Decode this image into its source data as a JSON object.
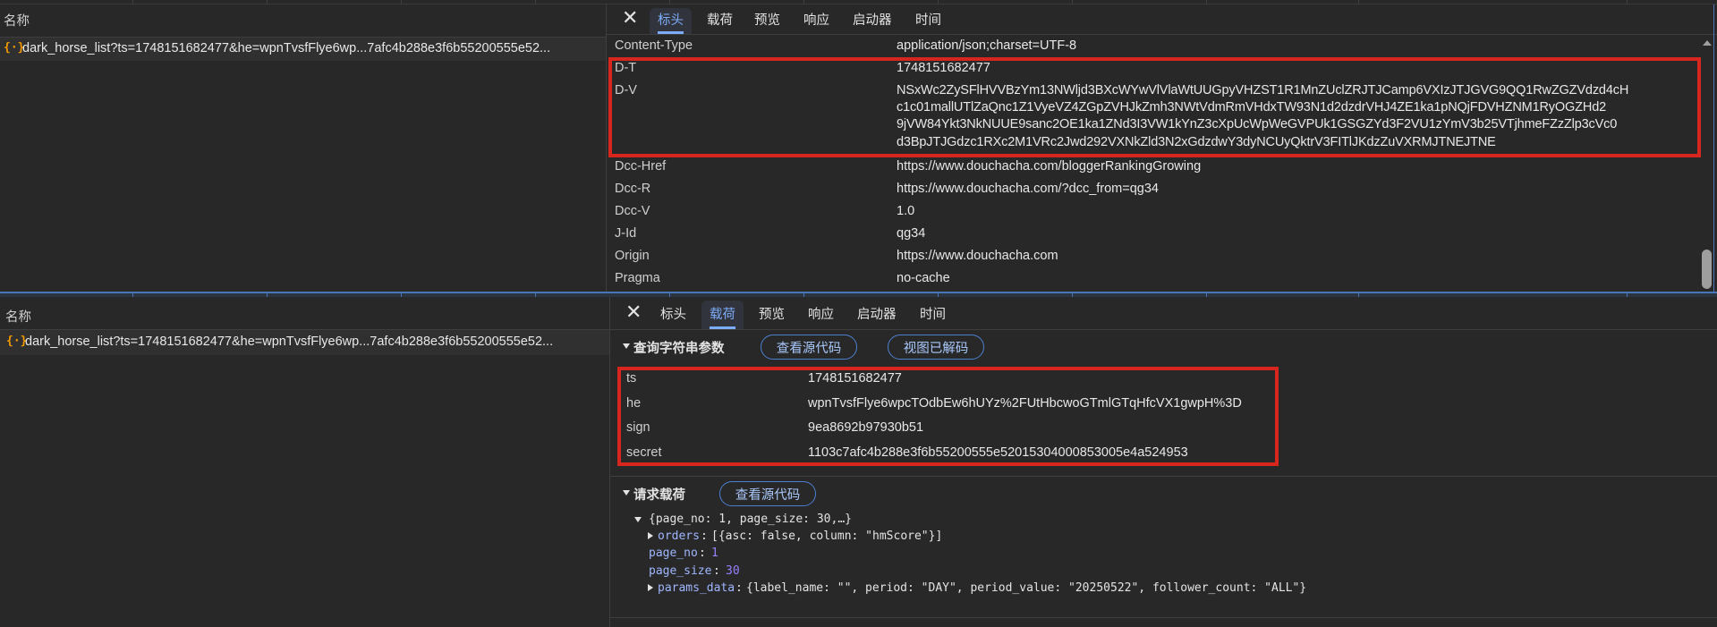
{
  "top": {
    "name_header": "名称",
    "request_name": "dark_horse_list?ts=1748151682477&he=wpnTvsfFlye6wp...7afc4b288e3f6b55200555e52...",
    "tabs": [
      "标头",
      "载荷",
      "预览",
      "响应",
      "启动器",
      "时间"
    ],
    "active_tab": "标头",
    "headers": [
      {
        "k": "Content-Type",
        "v": [
          "application/json;charset=UTF-8"
        ]
      },
      {
        "k": "D-T",
        "v": [
          "1748151682477"
        ]
      },
      {
        "k": "D-V",
        "v": [
          "NSxWc2ZySFlHVVBzYm13NWljd3BXcWYwVlVlaWtUUGpyVHZST1R1MnZUclZRJTJCamp6VXIzJTJGVG9QQ1RwZGZVdzd4cH",
          "c1c01mallUTlZaQnc1Z1VyeVZ4ZGpZVHJkZmh3NWtVdmRmVHdxTW93N1d2dzdrVHJ4ZE1ka1pNQjFDVHZNM1RyOGZHd2",
          "9jVW84Ykt3NkNUUE9sanc2OE1ka1ZNd3I3VW1kYnZ3cXpUcWpWeGVPUk1GSGZYd3F2VU1zYmV3b25VTjhmeFZzZlp3cVc0",
          "d3BpJTJGdzc1RXc2M1VRc2Jwd292VXNkZld3N2xGdzdwY3dyNCUyQktrV3FITlJKdzZuVXRMJTNEJTNE"
        ]
      },
      {
        "k": "Dcc-Href",
        "v": [
          "https://www.douchacha.com/bloggerRankingGrowing"
        ]
      },
      {
        "k": "Dcc-R",
        "v": [
          "https://www.douchacha.com/?dcc_from=qg34"
        ]
      },
      {
        "k": "Dcc-V",
        "v": [
          "1.0"
        ]
      },
      {
        "k": "J-Id",
        "v": [
          "qg34"
        ]
      },
      {
        "k": "Origin",
        "v": [
          "https://www.douchacha.com"
        ]
      },
      {
        "k": "Pragma",
        "v": [
          "no-cache"
        ]
      }
    ]
  },
  "bottom": {
    "name_header": "名称",
    "request_name": "dark_horse_list?ts=1748151682477&he=wpnTvsfFlye6wp...7afc4b288e3f6b55200555e52...",
    "tabs": [
      "标头",
      "载荷",
      "预览",
      "响应",
      "启动器",
      "时间"
    ],
    "active_tab": "载荷",
    "query_section": {
      "title": "查询字符串参数",
      "view_source": "查看源代码",
      "view_decoded": "视图已解码",
      "params": [
        {
          "k": "ts",
          "v": "1748151682477"
        },
        {
          "k": "he",
          "v": "wpnTvsfFlye6wpcTOdbEw6hUYz%2FUtHbcwoGTmlGTqHfcVX1gwpH%3D"
        },
        {
          "k": "sign",
          "v": "9ea8692b97930b51"
        },
        {
          "k": "secret",
          "v": "1103c7afc4b288e3f6b55200555e52015304000853005e4a524953"
        }
      ]
    },
    "payload_section": {
      "title": "请求载荷",
      "view_source": "查看源代码",
      "root_summary": "{page_no: 1, page_size: 30,…}",
      "orders_key": "orders",
      "orders_summary": "[{asc: false, column: \"hmScore\"}]",
      "page_no_key": "page_no",
      "page_no_val": "1",
      "page_size_key": "page_size",
      "page_size_val": "30",
      "params_key": "params_data",
      "params_summary": "{label_name: \"\", period: \"DAY\", period_value: \"20250522\", follower_count: \"ALL\"}"
    }
  },
  "icons": {
    "file": "json-file-icon",
    "close": "close-icon",
    "expand": "triangle-expand-icon"
  },
  "colors": {
    "accent": "#7cacf8",
    "highlight_box": "#d7261e",
    "bg": "#282828",
    "panel_divider": "#4a76b8"
  }
}
